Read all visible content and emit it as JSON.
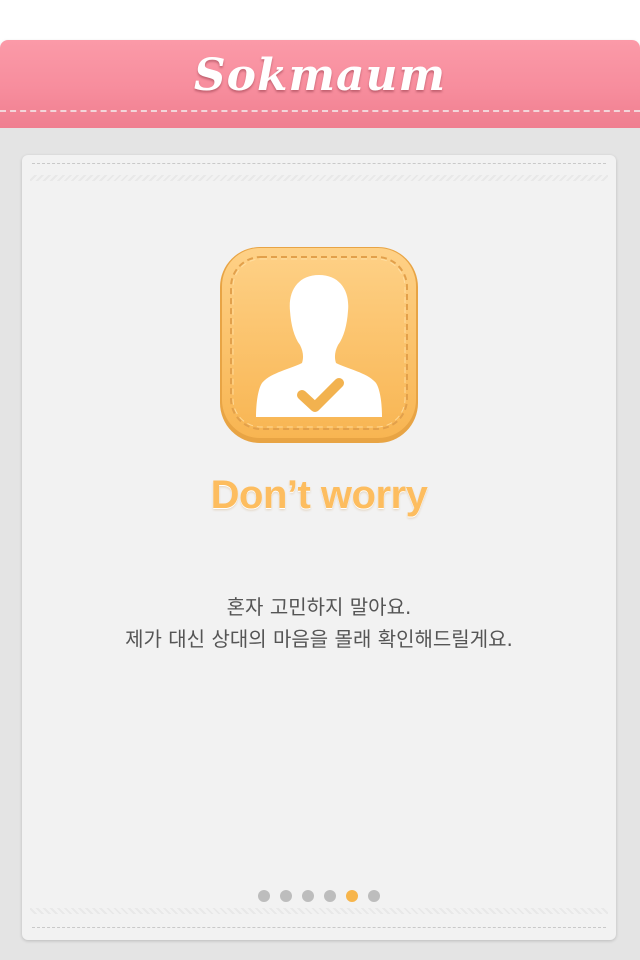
{
  "header": {
    "title": "Sokmaum"
  },
  "onboarding": {
    "icon": "person-check-icon",
    "headline": "Don’t worry",
    "description_lines": [
      "혼자 고민하지 말아요.",
      "제가 대신 상대의 마음을 몰래 확인해드릴게요."
    ]
  },
  "pager": {
    "total_pages": 6,
    "current_page": 5
  },
  "colors": {
    "header_pink": "#f78d9d",
    "icon_orange": "#fcc46a",
    "headline_orange": "#fdbd5f",
    "active_dot": "#f7b54b",
    "inactive_dot": "#bdbdbd"
  }
}
